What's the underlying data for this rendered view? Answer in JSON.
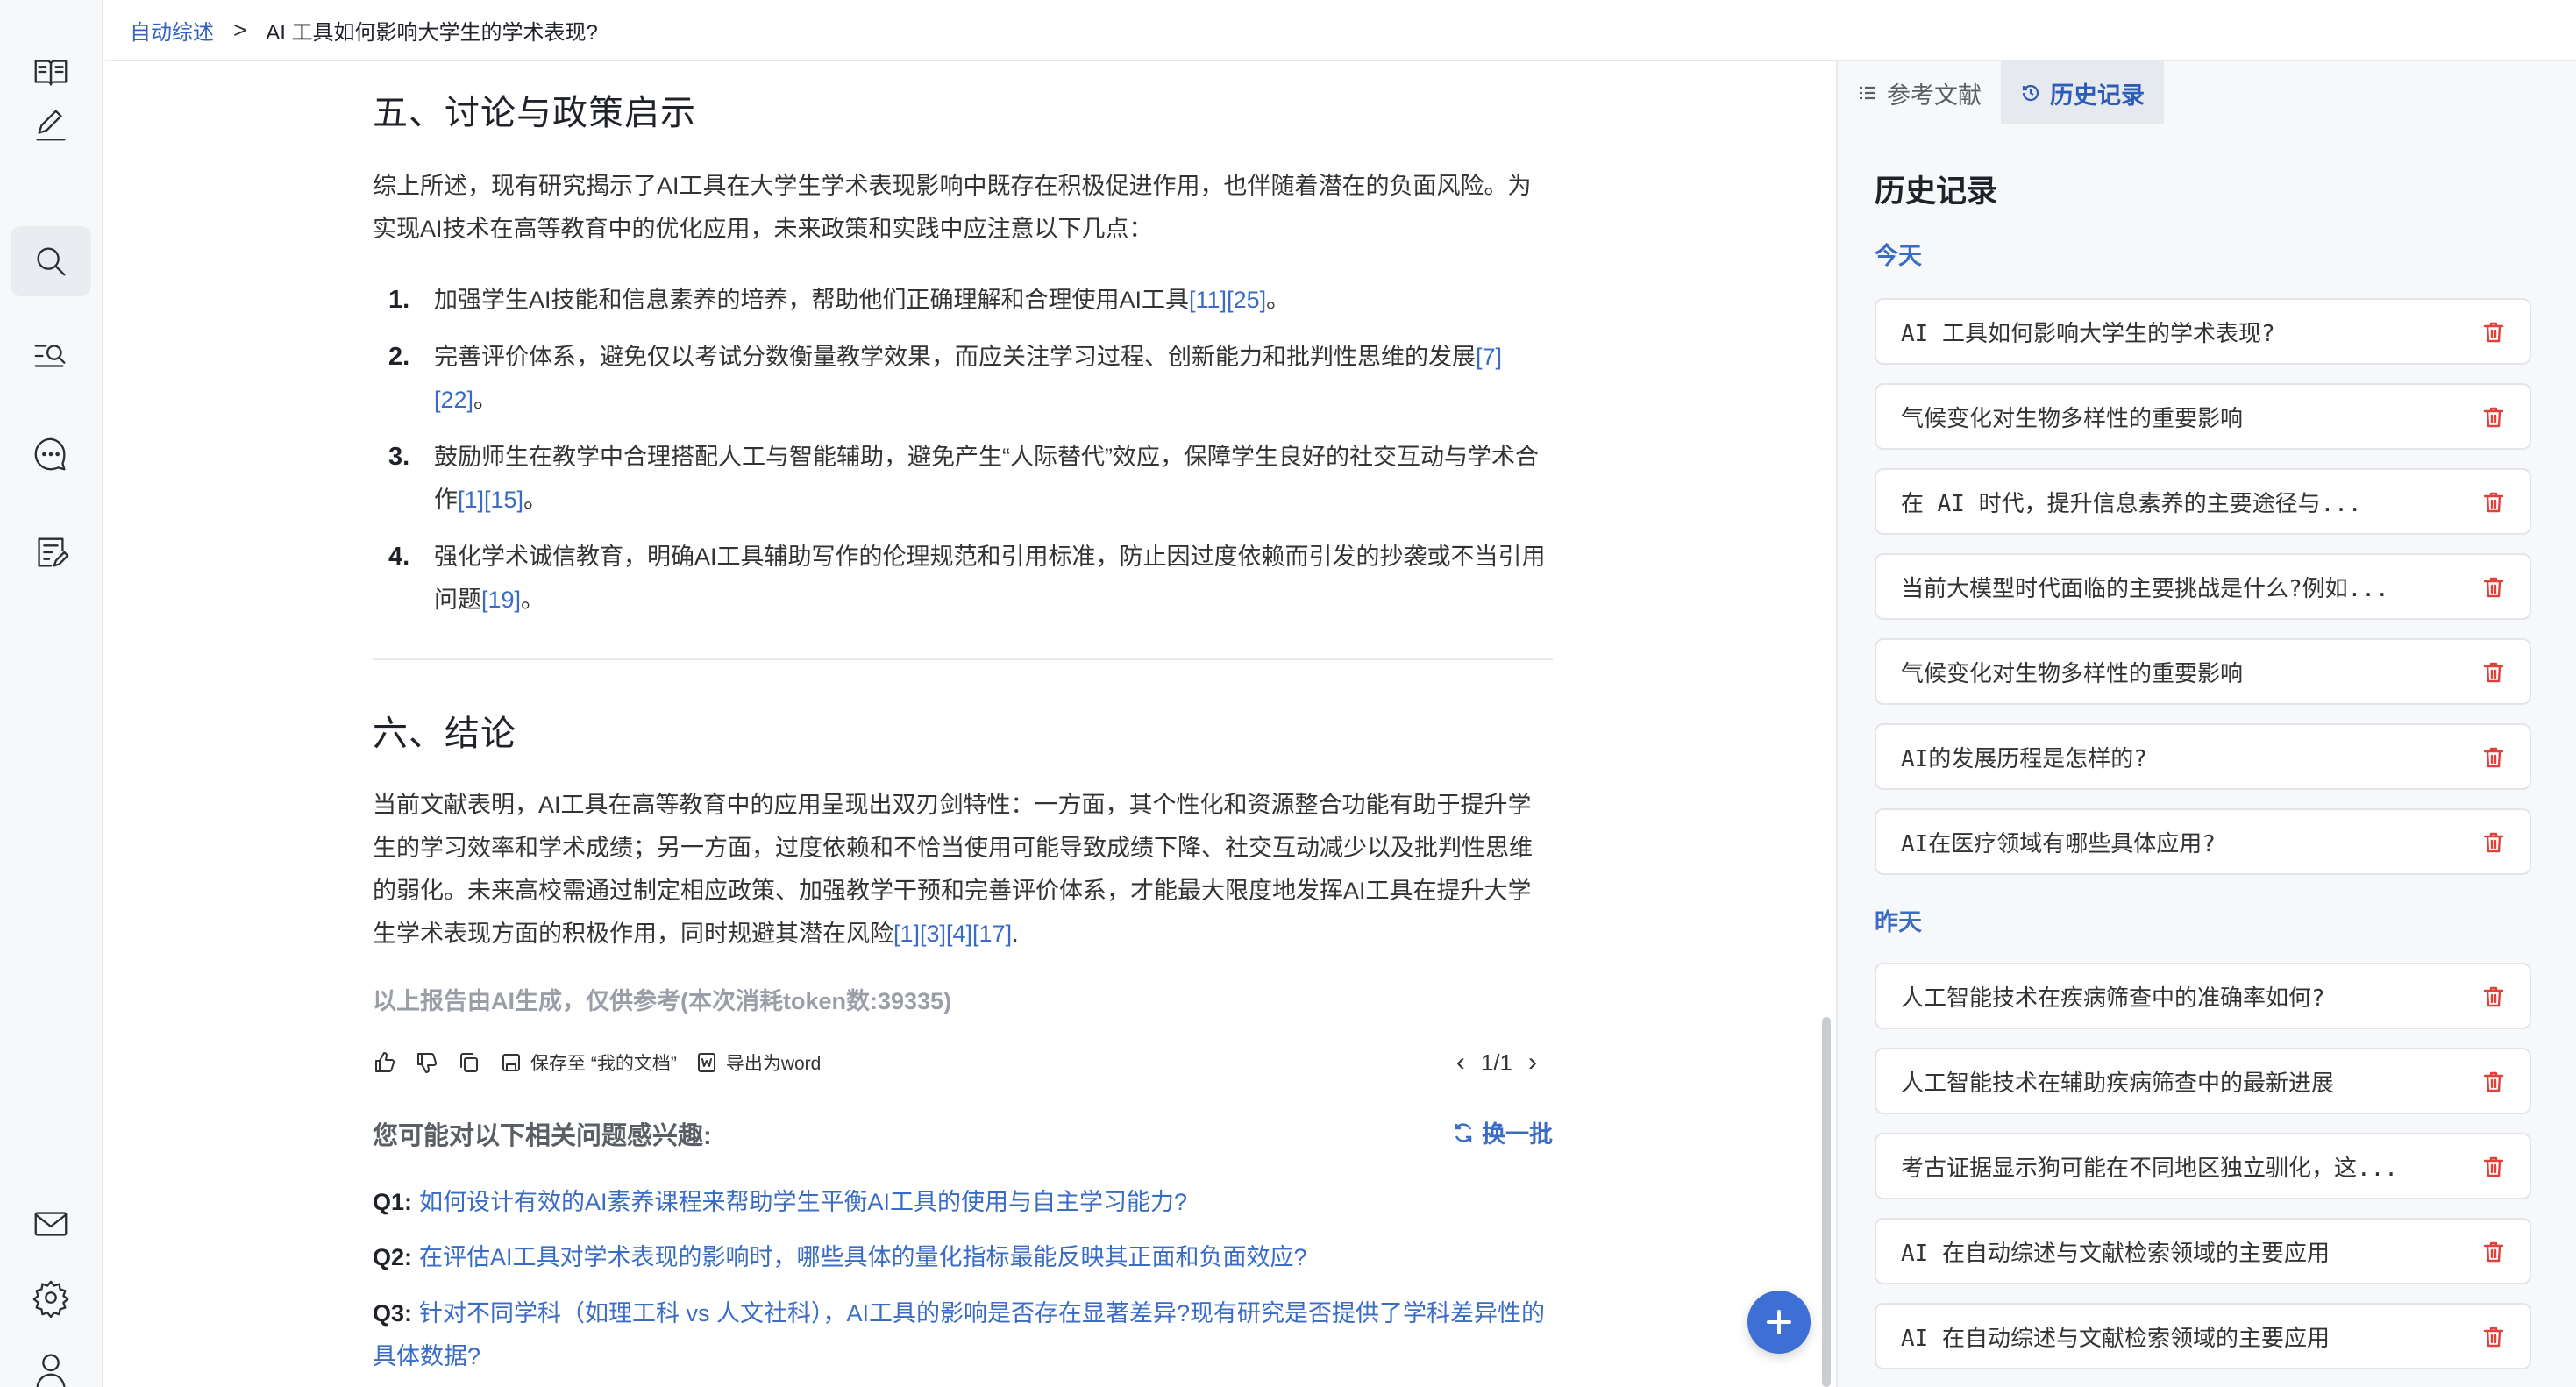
{
  "breadcrumb": {
    "root": "自动综述",
    "separator": ">",
    "current": "AI 工具如何影响大学生的学术表现?"
  },
  "sidebar": {
    "items": [
      {
        "name": "reader-icon"
      },
      {
        "name": "edit-icon"
      },
      {
        "name": "search-icon",
        "active": true
      },
      {
        "name": "text-search-icon"
      },
      {
        "name": "chat-icon"
      },
      {
        "name": "note-edit-icon"
      }
    ],
    "bottom": [
      {
        "name": "mail-icon"
      },
      {
        "name": "settings-icon"
      },
      {
        "name": "user-icon"
      }
    ]
  },
  "article": {
    "section5": {
      "title": "五、讨论与政策启示",
      "intro": "综上所述，现有研究揭示了AI工具在大学生学术表现影响中既存在积极促进作用，也伴随着潜在的负面风险。为实现AI技术在高等教育中的优化应用，未来政策和实践中应注意以下几点：",
      "items": [
        {
          "num": "1.",
          "text": "加强学生AI技能和信息素养的培养，帮助他们正确理解和合理使用AI工具",
          "cite": "[11][25]",
          "end": "。"
        },
        {
          "num": "2.",
          "text": "完善评价体系，避免仅以考试分数衡量教学效果，而应关注学习过程、创新能力和批判性思维的发展",
          "cite": "[7][22]",
          "end": "。"
        },
        {
          "num": "3.",
          "text": "鼓励师生在教学中合理搭配人工与智能辅助，避免产生“人际替代”效应，保障学生良好的社交互动与学术合作",
          "cite": "[1][15]",
          "end": "。"
        },
        {
          "num": "4.",
          "text": "强化学术诚信教育，明确AI工具辅助写作的伦理规范和引用标准，防止因过度依赖而引发的抄袭或不当引用问题",
          "cite": "[19]",
          "end": "。"
        }
      ]
    },
    "section6": {
      "title": "六、结论",
      "text": "当前文献表明，AI工具在高等教育中的应用呈现出双刃剑特性：一方面，其个性化和资源整合功能有助于提升学生的学习效率和学术成绩；另一方面，过度依赖和不恰当使用可能导致成绩下降、社交互动减少以及批判性思维的弱化。未来高校需通过制定相应政策、加强教学干预和完善评价体系，才能最大限度地发挥AI工具在提升大学生学术表现方面的积极作用，同时规避其潜在风险",
      "cite": "[1][3][4][17]",
      "end": "."
    },
    "disclaimer": "以上报告由AI生成，仅供参考(本次消耗token数:39335)",
    "actions": {
      "save_label": "保存至 “我的文档”",
      "export_label": "导出为word"
    },
    "pager": {
      "prev": "‹",
      "text": "1/1",
      "next": "›"
    },
    "related": {
      "title": "您可能对以下相关问题感兴趣:",
      "refresh_label": "换一批",
      "questions": [
        {
          "label": "Q1:",
          "text": "如何设计有效的AI素养课程来帮助学生平衡AI工具的使用与自主学习能力?"
        },
        {
          "label": "Q2:",
          "text": "在评估AI工具对学术表现的影响时，哪些具体的量化指标最能反映其正面和负面效应?"
        },
        {
          "label": "Q3:",
          "text": "针对不同学科（如理工科 vs 人文社科），AI工具的影响是否存在显著差异?现有研究是否提供了学科差异性的具体数据?"
        }
      ]
    }
  },
  "panel": {
    "tabs": [
      {
        "label": "参考文献",
        "active": false
      },
      {
        "label": "历史记录",
        "active": true
      }
    ],
    "title": "历史记录",
    "groups": [
      {
        "label": "今天",
        "items": [
          "AI 工具如何影响大学生的学术表现?",
          "气候变化对生物多样性的重要影响",
          "在 AI 时代，提升信息素养的主要途径与...",
          "当前大模型时代面临的主要挑战是什么?例如...",
          "气候变化对生物多样性的重要影响",
          "AI的发展历程是怎样的?",
          "AI在医疗领域有哪些具体应用?"
        ]
      },
      {
        "label": "昨天",
        "items": [
          "人工智能技术在疾病筛查中的准确率如何?",
          "人工智能技术在辅助疾病筛查中的最新进展",
          "考古证据显示狗可能在不同地区独立驯化，这...",
          "AI 在自动综述与文献检索领域的主要应用",
          "AI 在自动综述与文献检索领域的主要应用"
        ]
      }
    ]
  },
  "colors": {
    "accent": "#3a6cc4",
    "delete": "#e0413a",
    "fab": "#3d6fd4"
  }
}
